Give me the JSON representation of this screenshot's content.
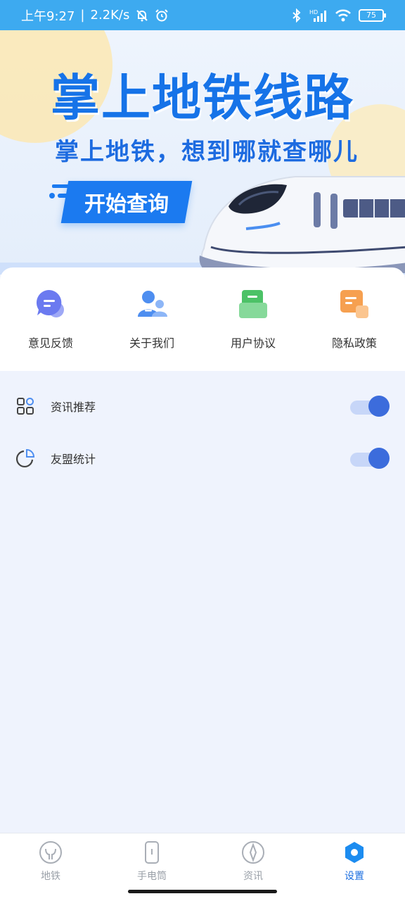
{
  "status_bar": {
    "time": "上午9:27",
    "speed": "2.2K/s",
    "battery": "75",
    "network_label": "HD"
  },
  "banner": {
    "title": "掌上地铁线路",
    "subtitle": "掌上地铁，想到哪就查哪儿",
    "cta_label": "开始查询"
  },
  "shortcuts": [
    {
      "label": "意见反馈",
      "icon": "chat-bubble-icon",
      "color": "#6b7af0"
    },
    {
      "label": "关于我们",
      "icon": "people-icon",
      "color": "#4e8ef0"
    },
    {
      "label": "用户协议",
      "icon": "agreement-icon",
      "color": "#4cc267"
    },
    {
      "label": "隐私政策",
      "icon": "privacy-doc-icon",
      "color": "#f6a050"
    }
  ],
  "settings": [
    {
      "label": "资讯推荐",
      "icon": "grid-apps-icon",
      "enabled": true
    },
    {
      "label": "友盟统计",
      "icon": "pie-chart-icon",
      "enabled": true
    }
  ],
  "bottom_nav": [
    {
      "label": "地铁",
      "icon": "metro-icon",
      "active": false
    },
    {
      "label": "手电筒",
      "icon": "flashlight-icon",
      "active": false
    },
    {
      "label": "资讯",
      "icon": "compass-icon",
      "active": false
    },
    {
      "label": "设置",
      "icon": "settings-hex-icon",
      "active": true
    }
  ],
  "colors": {
    "status_bar": "#3daaf0",
    "accent": "#1c6fe0",
    "toggle_on": "#3c6cdc",
    "page_bg": "#eff3fd"
  }
}
